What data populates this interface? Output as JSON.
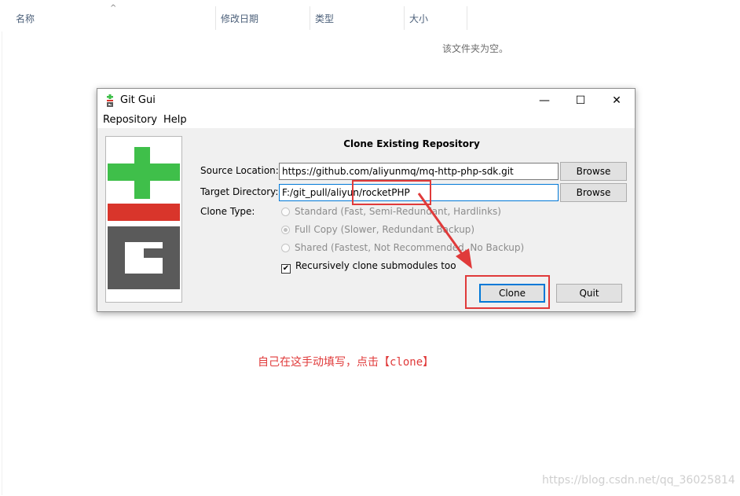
{
  "explorer": {
    "columns": [
      "名称",
      "修改日期",
      "类型",
      "大小"
    ],
    "sort_arrow": "^",
    "empty_message": "该文件夹为空。"
  },
  "window": {
    "title": "Git Gui",
    "minimize": "—",
    "maximize": "☐",
    "close": "✕",
    "menu": [
      "Repository",
      "Help"
    ]
  },
  "dialog": {
    "title": "Clone Existing Repository",
    "source_label": "Source Location:",
    "source_value": "https://github.com/aliyunmq/mq-http-php-sdk.git",
    "target_label": "Target Directory:",
    "target_value": "F:/git_pull/aliyun/rocketPHP",
    "browse": "Browse",
    "clone_type_label": "Clone Type:",
    "clone_types": [
      {
        "label": "Standard (Fast, Semi-Redundant, Hardlinks)",
        "selected": false
      },
      {
        "label": "Full Copy (Slower, Redundant Backup)",
        "selected": true
      },
      {
        "label": "Shared (Fastest, Not Recommended, No Backup)",
        "selected": false
      }
    ],
    "recursive_label": "Recursively clone submodules too",
    "recursive_checked": "✔",
    "clone_button": "Clone",
    "quit_button": "Quit"
  },
  "annotation": {
    "text_prefix": "自己在这手动填写，点击【",
    "text_code": "clone",
    "text_suffix": "】",
    "color": "#e03a3a"
  },
  "watermark": "https://blog.csdn.net/qq_36025814",
  "colors": {
    "logo_green": "#3fbf4a",
    "logo_red": "#d9352b",
    "logo_gray": "#5a5a5a",
    "focus_blue": "#0078d7"
  }
}
